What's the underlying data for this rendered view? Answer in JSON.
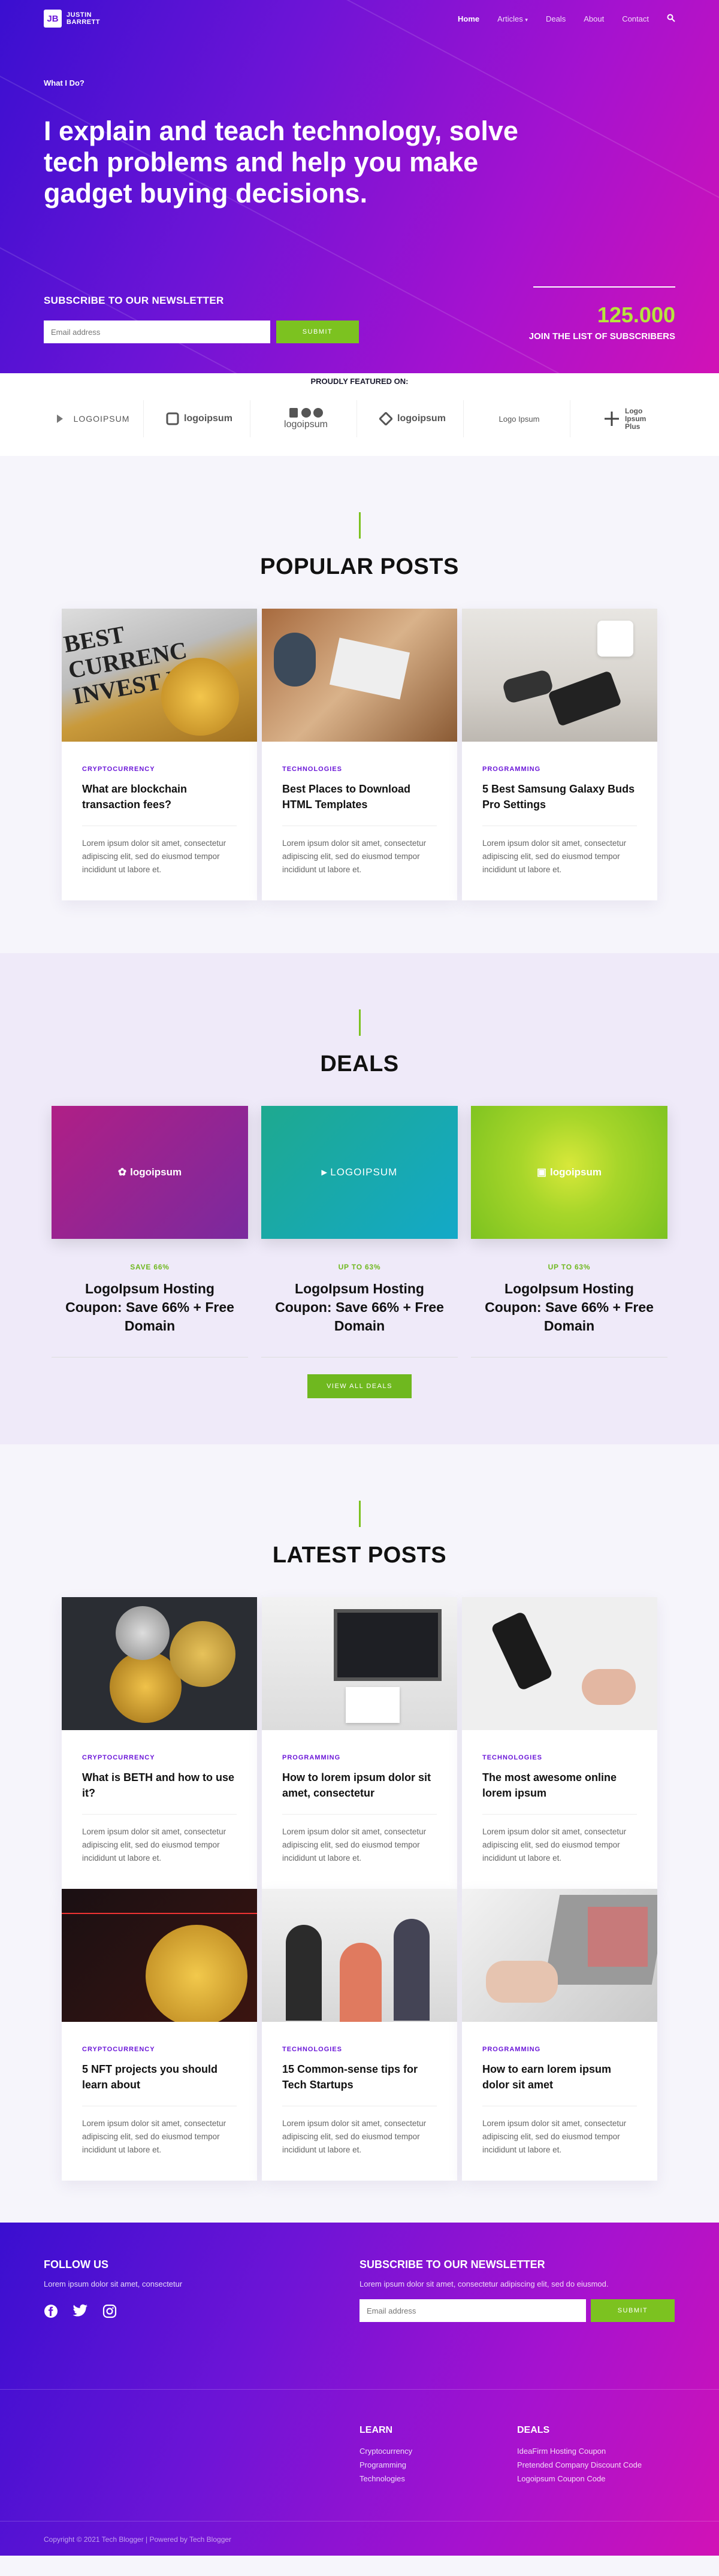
{
  "nav": {
    "logo_mark": "JB",
    "logo_text": "JUSTIN BARRETT",
    "items": [
      "Home",
      "Articles",
      "Deals",
      "About",
      "Contact"
    ]
  },
  "hero": {
    "eyebrow": "What I Do?",
    "headline": "I explain and teach technology, solve tech problems and help you make gadget buying decisions.",
    "newsletter_title": "SUBSCRIBE TO OUR NEWSLETTER",
    "email_placeholder": "Email address",
    "submit_label": "SUBMIT",
    "subscriber_count": "125.000",
    "subscriber_label": "JOIN THE LIST OF SUBSCRIBERS"
  },
  "featured": {
    "title": "PROUDLY FEATURED ON:",
    "logos": [
      "LOGOIPSUM",
      "logoipsum",
      "logoipsum",
      "logoipsum",
      "Logo Ipsum",
      "Logo Ipsum Plus"
    ]
  },
  "popular": {
    "title": "POPULAR POSTS",
    "posts": [
      {
        "category": "CRYPTOCURRENCY",
        "title": "What are blockchain transaction fees?",
        "excerpt": "Lorem ipsum dolor sit amet, consectetur adipiscing elit, sed do eiusmod tempor incididunt ut labore et."
      },
      {
        "category": "TECHNOLOGIES",
        "title": "Best Places to Download HTML Templates",
        "excerpt": "Lorem ipsum dolor sit amet, consectetur adipiscing elit, sed do eiusmod tempor incididunt ut labore et."
      },
      {
        "category": "PROGRAMMING",
        "title": "5 Best Samsung Galaxy Buds Pro Settings",
        "excerpt": "Lorem ipsum dolor sit amet, consectetur adipiscing elit, sed do eiusmod tempor incididunt ut labore et."
      }
    ]
  },
  "deals": {
    "title": "DEALS",
    "button": "VIEW ALL DEALS",
    "items": [
      {
        "logo": "logoipsum",
        "badge": "SAVE 66%",
        "title": "LogoIpsum Hosting Coupon: Save 66% + Free Domain"
      },
      {
        "logo": "LOGOIPSUM",
        "badge": "UP TO 63%",
        "title": "LogoIpsum Hosting Coupon: Save 66% + Free Domain"
      },
      {
        "logo": "logoipsum",
        "badge": "UP TO 63%",
        "title": "LogoIpsum Hosting Coupon: Save 66% + Free Domain"
      }
    ]
  },
  "latest": {
    "title": "LATEST POSTS",
    "posts": [
      {
        "category": "CRYPTOCURRENCY",
        "title": "What is BETH and how to use it?",
        "excerpt": "Lorem ipsum dolor sit amet, consectetur adipiscing elit, sed do eiusmod tempor incididunt ut labore et."
      },
      {
        "category": "PROGRAMMING",
        "title": "How to lorem ipsum dolor sit amet, consectetur",
        "excerpt": "Lorem ipsum dolor sit amet, consectetur adipiscing elit, sed do eiusmod tempor incididunt ut labore et."
      },
      {
        "category": "TECHNOLOGIES",
        "title": "The most awesome online lorem ipsum",
        "excerpt": "Lorem ipsum dolor sit amet, consectetur adipiscing elit, sed do eiusmod tempor incididunt ut labore et."
      },
      {
        "category": "CRYPTOCURRENCY",
        "title": "5 NFT projects you should learn about",
        "excerpt": "Lorem ipsum dolor sit amet, consectetur adipiscing elit, sed do eiusmod tempor incididunt ut labore et."
      },
      {
        "category": "TECHNOLOGIES",
        "title": "15 Common-sense tips for Tech Startups",
        "excerpt": "Lorem ipsum dolor sit amet, consectetur adipiscing elit, sed do eiusmod tempor incididunt ut labore et."
      },
      {
        "category": "PROGRAMMING",
        "title": "How to earn lorem ipsum dolor sit amet",
        "excerpt": "Lorem ipsum dolor sit amet, consectetur adipiscing elit, sed do eiusmod tempor incididunt ut labore et."
      }
    ]
  },
  "footer": {
    "follow_title": "FOLLOW US",
    "follow_text": "Lorem ipsum dolor sit amet, consectetur",
    "newsletter_title": "SUBSCRIBE TO OUR NEWSLETTER",
    "newsletter_text": "Lorem ipsum dolor sit amet, consectetur adipiscing elit, sed do eiusmod.",
    "email_placeholder": "Email address",
    "submit_label": "SUBMIT",
    "learn_title": "LEARN",
    "learn_links": [
      "Cryptocurrency",
      "Programming",
      "Technologies"
    ],
    "deals_title": "DEALS",
    "deals_links": [
      "IdeaFirm Hosting Coupon",
      "Pretended Company Discount Code",
      "Logoipsum Coupon Code"
    ],
    "copyright": "Copyright © 2021 Tech Blogger | Powered by Tech Blogger"
  },
  "colors": {
    "accent": "#7cc220",
    "purple": "#6b17d8",
    "magenta": "#d112b6"
  }
}
